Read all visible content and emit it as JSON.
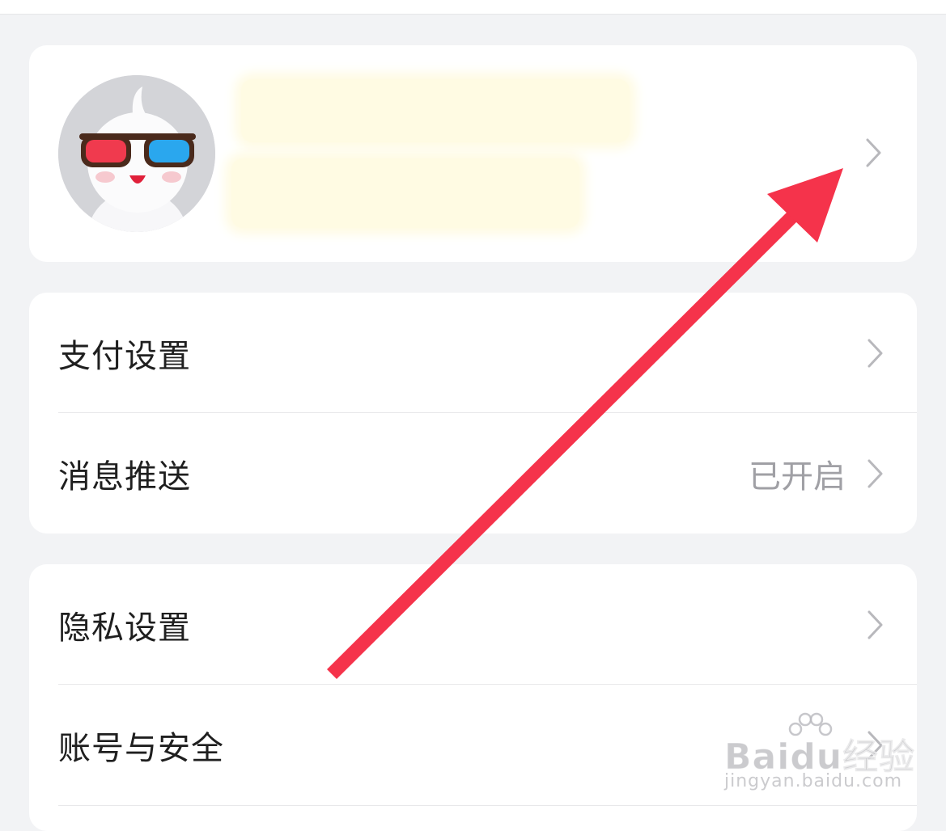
{
  "profile": {
    "avatar_icon": "mascot-avatar-3d-glasses",
    "name_redacted": true
  },
  "sections": [
    {
      "items": [
        {
          "label": "支付设置",
          "value": ""
        },
        {
          "label": "消息推送",
          "value": "已开启"
        }
      ]
    },
    {
      "items": [
        {
          "label": "隐私设置",
          "value": ""
        },
        {
          "label": "账号与安全",
          "value": ""
        }
      ]
    }
  ],
  "annotation": {
    "arrow_color": "#f5334b",
    "arrow_icon": "arrow-up-right"
  },
  "watermark": {
    "main_latin": "Bai",
    "main_du": "du",
    "main_cn": "经验",
    "sub": "jingyan.baidu.com"
  },
  "colors": {
    "background": "#f2f3f5",
    "card": "#ffffff",
    "label": "#1f1f1f",
    "value": "#a0a0a5",
    "chevron": "#b8b8bc"
  }
}
